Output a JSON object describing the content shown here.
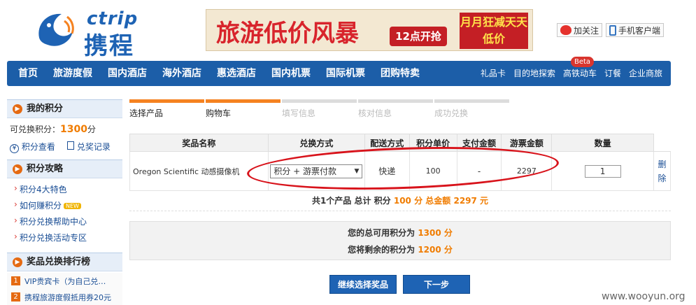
{
  "header": {
    "logo_en": "ctrip",
    "logo_cn": "携程",
    "banner": {
      "text1": "旅游低价风暴",
      "text2": "12点开抢",
      "text3": "月月狂减天天低价"
    },
    "weibo_label": "加关注",
    "mobile_label": "手机客户端"
  },
  "nav": {
    "main": [
      "首页",
      "旅游度假",
      "国内酒店",
      "海外酒店",
      "惠选酒店",
      "国内机票",
      "国际机票",
      "团购特卖"
    ],
    "sub": [
      "礼品卡",
      "目的地探索",
      "高铁动车",
      "订餐",
      "企业商旅"
    ],
    "beta": "Beta"
  },
  "sidebar": {
    "my_points": {
      "title": "我的积分",
      "available_label": "可兑换积分：",
      "available_value": "1300",
      "available_unit": "分",
      "link1": "积分查看",
      "link2": "兑奖记录"
    },
    "guide": {
      "title": "积分攻略",
      "items": [
        "积分4大特色",
        "如何赚积分",
        "积分兑换帮助中心",
        "积分兑换活动专区"
      ],
      "new_badge": "NEW"
    },
    "ranking": {
      "title": "奖品兑换排行榜",
      "items": [
        {
          "num": "1",
          "label": "VIP贵宾卡（为自己兑…"
        },
        {
          "num": "2",
          "label": "携程旅游度假抵用券20元"
        }
      ]
    }
  },
  "steps": [
    "选择产品",
    "购物车",
    "填写信息",
    "核对信息",
    "成功兑换"
  ],
  "cart": {
    "headers": [
      "奖品名称",
      "兑换方式",
      "配送方式",
      "积分单价",
      "支付金额",
      "游票金额",
      "数量"
    ],
    "row": {
      "name": "Oregon Scientific 动感摄像机",
      "method": "积分 + 游票付款",
      "delivery": "快递",
      "unit_points": "100",
      "pay_amount": "-",
      "ticket_amount": "2297",
      "quantity": "1",
      "delete": "删除"
    },
    "summary": {
      "prefix": "共1个产品  总计  积分",
      "points": "100 分",
      "total_label": "总金额",
      "total": "2297 元"
    }
  },
  "totals": {
    "line1_label": "您的总可用积分为",
    "line1_value": "1300 分",
    "line2_label": "您将剩余的积分为",
    "line2_value": "1200 分"
  },
  "buttons": {
    "continue": "继续选择奖品",
    "next": "下一步"
  },
  "watermark": "www.wooyun.org"
}
